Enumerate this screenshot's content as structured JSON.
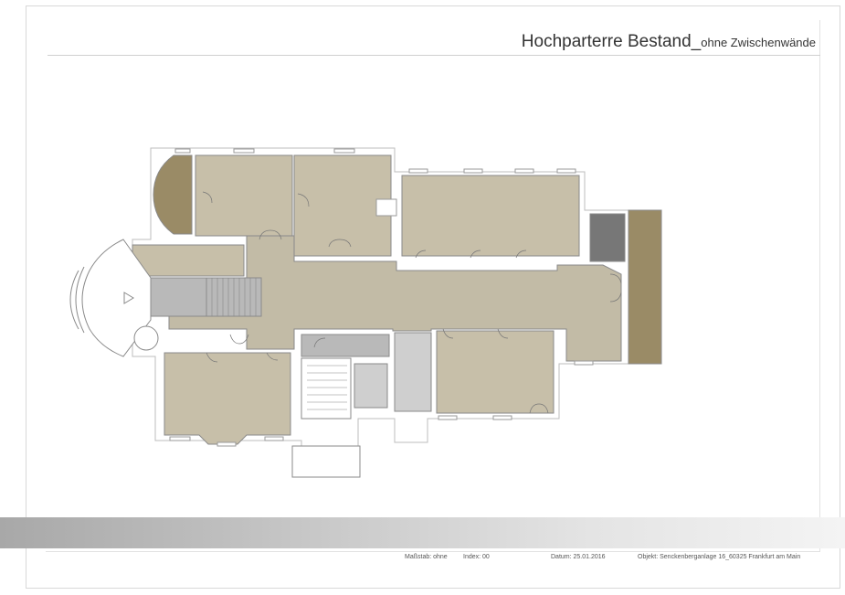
{
  "title": {
    "main": "Hochparterre Bestand_",
    "sub": "ohne Zwischenwände"
  },
  "footer": {
    "scale": "Maßstab: ohne",
    "index": "Index: 00",
    "date": "Datum: 25.01.2016",
    "object": "Objekt: Senckenberganlage 16_60325 Frankfurt am Main"
  },
  "colors": {
    "room": "#c7bfa9",
    "corridor": "#c2bba6",
    "stair": "#b9b9b9",
    "wet": "#cfcfcf",
    "terrace": "#9a8b66",
    "dark_room": "#777777",
    "wall": "#8a8a8a",
    "band_start": "#a8a8a8"
  }
}
